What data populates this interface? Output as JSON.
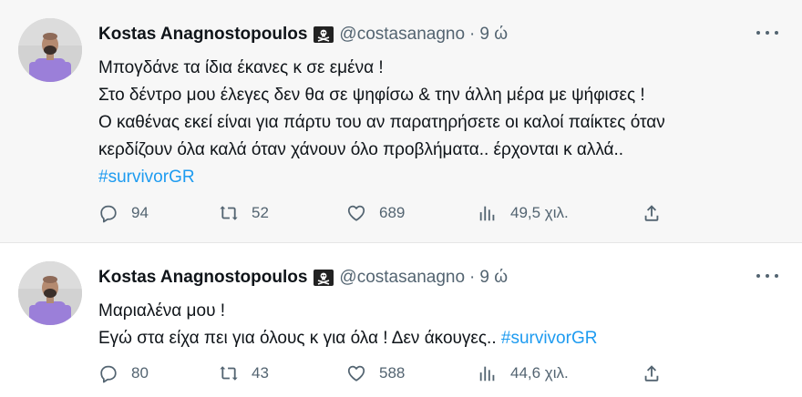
{
  "tweets": [
    {
      "name": "Kostas Anagnostopoulos",
      "handle": "@costasanagno",
      "separator": "·",
      "time": "9 ώ",
      "lines": [
        "Μπογδάνε τα ίδια έκανες κ σε εμένα !",
        "Στο δέντρο μου έλεγες δεν θα σε ψηφίσω & την άλλη μέρα με ψήφισες !",
        "Ο καθένας εκεί είναι για πάρτυ του αν παρατηρήσετε οι καλοί παίκτες όταν",
        "κερδίζουν όλα καλά όταν χάνουν όλο προβλήματα.. έρχονται κ αλλά.."
      ],
      "hashtag": "#survivorGR",
      "replies": "94",
      "retweets": "52",
      "likes": "689",
      "views": "49,5 χιλ."
    },
    {
      "name": "Kostas Anagnostopoulos",
      "handle": "@costasanagno",
      "separator": "·",
      "time": "9 ώ",
      "lines": [
        "Μαριαλένα μου !",
        "Εγώ στα είχα πει για όλους κ για όλα ! Δεν άκουγες.. "
      ],
      "hashtag": "#survivorGR",
      "replies": "80",
      "retweets": "43",
      "likes": "588",
      "views": "44,6 χιλ."
    }
  ],
  "icons": {
    "name_badge": "pirate-flag-icon",
    "more": "more-horizontal-icon",
    "reply": "reply-icon",
    "retweet": "retweet-icon",
    "like": "heart-icon",
    "views": "views-bar-chart-icon",
    "share": "share-icon"
  },
  "colors": {
    "hashtag": "#1d9bf0",
    "secondary_text": "#536471",
    "primary_text": "#0f1419",
    "first_tweet_bg": "#f7f7f7",
    "avatar_shirt": "#9b7fd9"
  }
}
